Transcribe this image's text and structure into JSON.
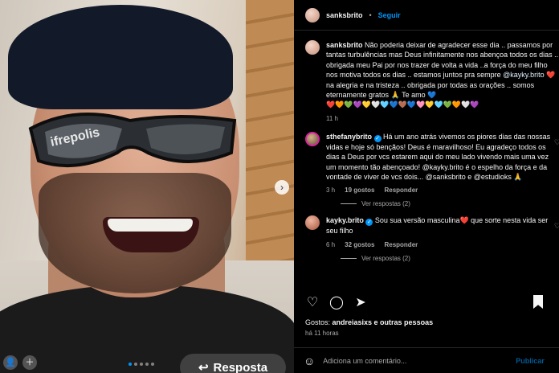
{
  "post": {
    "author": "sanksbrito",
    "separator": "•",
    "follow_label": "Seguir"
  },
  "caption": {
    "username": "sanksbrito",
    "text_part1": "Não poderia deixar de agradecer esse dia .. passamos por tantas turbulências mas Deus infinitamente nos abençoa todos os dias .. obrigada meu Pai por nos trazer de volta a vida ..a força do meu filho nos motiva todos os dias .. estamos juntos pra sempre ",
    "mention": "@kayky.brito",
    "text_part2": " ❤️ na alegria e na tristeza .. obrigada por todas as orações .. somos eternamente gratos 🙏 Te amo 💙",
    "hearts_row": "❤️🧡💚💜💛🤍🩵💙🤎💙🩷💛🩵💚🧡🤍💜",
    "time": "11 h"
  },
  "comments": [
    {
      "username": "sthefanybrito",
      "verified": "✓",
      "text": "Há um ano atrás vivemos os piores dias das nossas vidas e hoje só bençãos! Deus é maravilhoso! Eu agradeço todos os dias a Deus por vcs estarem aqui do meu lado vivendo mais uma vez um momento tão abençoado! @kayky.brito é o espelho da força e da vontade de viver de vcs dois... @sanksbrito e @estudioks 🙏",
      "time": "3 h",
      "likes": "19 gostos",
      "reply": "Responder",
      "view_replies": "Ver respostas (2)"
    },
    {
      "username": "kayky.brito",
      "verified": "✓",
      "text": "Sou sua versão masculina❤️ que sorte nesta vida ser seu filho",
      "time": "6 h",
      "likes": "32 gostos",
      "reply": "Responder",
      "view_replies": "Ver respostas (2)"
    }
  ],
  "likes_summary": {
    "prefix": "Gostos: ",
    "names": "andreiasixs e outras pessoas"
  },
  "post_time": "há 11 horas",
  "add_comment": {
    "placeholder": "Adiciona um comentário...",
    "publish_label": "Publicar"
  },
  "story": {
    "reply_label": "Resposta",
    "photo_text": "ifrepolis",
    "next_arrow": "›"
  },
  "colors": {
    "accent": "#0095f6",
    "background": "#000000",
    "muted": "#a8a8a8"
  }
}
